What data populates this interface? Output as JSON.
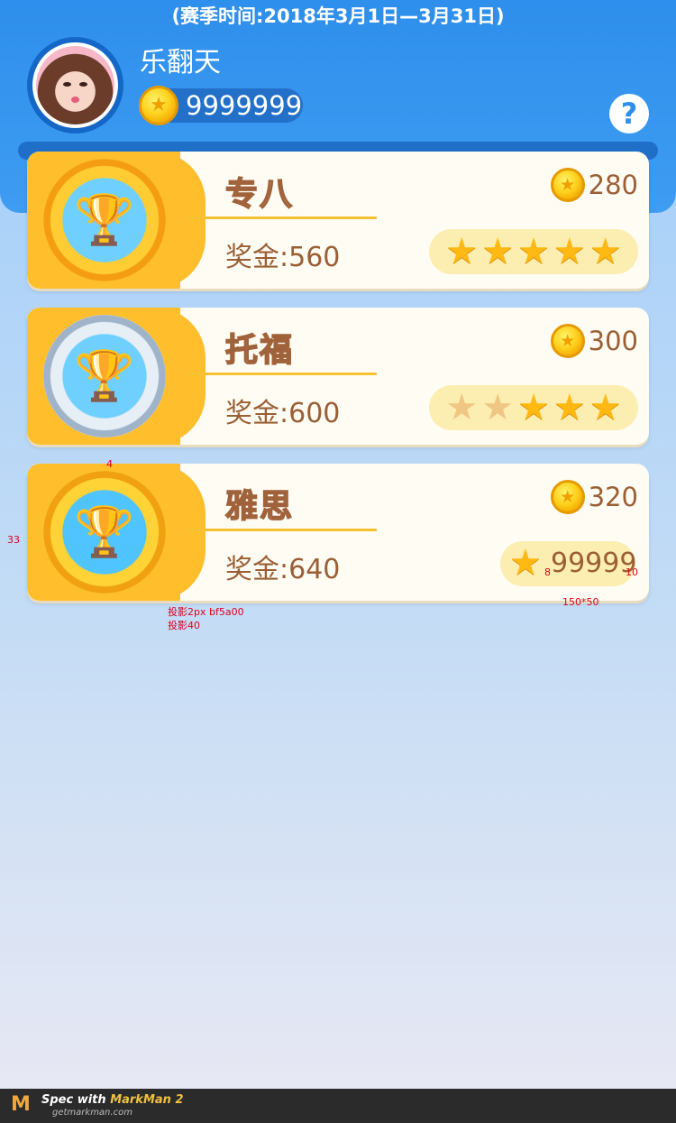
{
  "header": {
    "season": "(赛季时间:2018年3月1日—3月31日)",
    "username": "乐翻天",
    "coins": "9999999",
    "help_icon": "?"
  },
  "cards": [
    {
      "title": "专八",
      "cost": "280",
      "prize": "奖金:560",
      "stars": [
        true,
        true,
        true,
        true,
        true
      ],
      "medal": "gold"
    },
    {
      "title": "托福",
      "cost": "300",
      "prize": "奖金:600",
      "stars": [
        false,
        false,
        true,
        true,
        true
      ],
      "medal": "silver"
    },
    {
      "title": "雅思",
      "cost": "320",
      "prize": "奖金:640",
      "star_count": "99999",
      "medal": "gold"
    }
  ],
  "spec_annotations": {
    "a1": "4",
    "a2": "33",
    "a3": "投影2px bf5a00",
    "a4": "投影40",
    "a5": "8",
    "a6": "10",
    "a7": "150*50"
  },
  "footer": {
    "line1_prefix": "Spec with ",
    "line1_brand": "MarkMan 2",
    "line2": "getmarkman.com",
    "logo": "M"
  },
  "colors": {
    "header_blue": "#2e8fec",
    "badge_orange": "#ffbe2c",
    "text_brown": "#9b5f35",
    "star_gold": "#ffb912"
  }
}
